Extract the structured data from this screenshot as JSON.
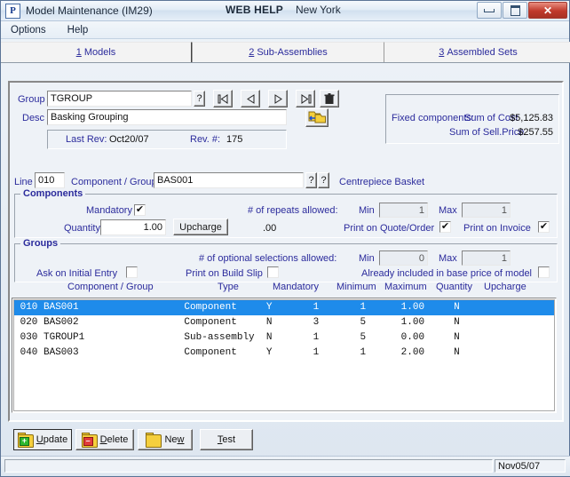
{
  "window": {
    "app_icon_letter": "P",
    "title": "Model Maintenance (IM29)",
    "web_help": "WEB HELP",
    "location": "New York",
    "minimize_label": "Minimize",
    "maximize_label": "Maximize",
    "close_label": "✕"
  },
  "menubar": {
    "items": [
      {
        "label": "Options"
      },
      {
        "label": "Help"
      }
    ]
  },
  "tabs": [
    {
      "accel": "1",
      "label": "Models",
      "selected": false
    },
    {
      "accel": "2",
      "label": "Sub-Assemblies",
      "selected": true
    },
    {
      "accel": "3",
      "label": "Assembled Sets",
      "selected": false
    }
  ],
  "header": {
    "group_label": "Group",
    "group_value": "TGROUP",
    "group_lookup": "?",
    "desc_label": "Desc",
    "desc_value": "Basking Grouping",
    "nav": {
      "first": "first-record",
      "prev": "previous-record",
      "next": "next-record",
      "last": "last-record",
      "delete": "delete-record"
    },
    "copy_label": "copy-group",
    "last_rev_label": "Last Rev:",
    "last_rev_value": "Oct20/07",
    "rev_num_label": "Rev. #:",
    "rev_num_value": "175"
  },
  "summary": {
    "fixed_label": "Fixed components:",
    "cost_label": "Sum of Cost",
    "cost_value": "$5,125.83",
    "sell_label": "Sum of Sell.Price",
    "sell_value": "$257.55"
  },
  "line": {
    "line_label": "Line",
    "line_value": "010",
    "component_label": "Component / Group",
    "component_value": "BAS001",
    "lookup1": "?",
    "lookup2": "?",
    "component_desc": "Centrepiece Basket"
  },
  "components": {
    "title": "Components",
    "mandatory_label": "Mandatory",
    "mandatory_checked": "✔",
    "quantity_label": "Quantity",
    "quantity_value": "1.00",
    "upcharge_button": "Upcharge",
    "upcharge_value": ".00",
    "repeats_label": "# of repeats allowed:",
    "min_label": "Min",
    "min_value": "1",
    "max_label": "Max",
    "max_value": "1",
    "print_quote_label": "Print on Quote/Order",
    "print_quote_checked": "✔",
    "print_invoice_label": "Print on Invoice",
    "print_invoice_checked": "✔"
  },
  "groups": {
    "title": "Groups",
    "optional_label": "# of optional selections allowed:",
    "min_label": "Min",
    "min_value": "0",
    "max_label": "Max",
    "max_value": "1",
    "ask_label": "Ask on Initial Entry",
    "ask_checked": "",
    "build_slip_label": "Print on Build Slip",
    "build_slip_checked": "",
    "base_price_label": "Already included in base price of model",
    "base_price_checked": ""
  },
  "grid": {
    "columns": [
      {
        "label": "Component / Group"
      },
      {
        "label": "Type"
      },
      {
        "label": "Mandatory"
      },
      {
        "label": "Minimum"
      },
      {
        "label": "Maximum"
      },
      {
        "label": "Quantity"
      },
      {
        "label": "Upcharge"
      }
    ],
    "rows": [
      {
        "line": "010",
        "component": "BAS001",
        "type": "Component",
        "mandatory": "Y",
        "minimum": "1",
        "maximum": "1",
        "quantity": "1.00",
        "upcharge": "N",
        "selected": true
      },
      {
        "line": "020",
        "component": "BAS002",
        "type": "Component",
        "mandatory": "N",
        "minimum": "3",
        "maximum": "5",
        "quantity": "1.00",
        "upcharge": "N",
        "selected": false
      },
      {
        "line": "030",
        "component": "TGROUP1",
        "type": "Sub-assembly",
        "mandatory": "N",
        "minimum": "1",
        "maximum": "5",
        "quantity": "0.00",
        "upcharge": "N",
        "selected": false
      },
      {
        "line": "040",
        "component": "BAS003",
        "type": "Component",
        "mandatory": "Y",
        "minimum": "1",
        "maximum": "1",
        "quantity": "2.00",
        "upcharge": "N",
        "selected": false
      }
    ]
  },
  "actions": [
    {
      "name": "update",
      "accel_before": "",
      "accel": "U",
      "rest": "pdate",
      "icon": "folder-plus",
      "focused": true
    },
    {
      "name": "delete",
      "accel_before": "",
      "accel": "D",
      "rest": "elete",
      "icon": "folder-minus",
      "focused": false
    },
    {
      "name": "new",
      "accel_before": "Ne",
      "accel": "w",
      "rest": "",
      "icon": "folder",
      "focused": false
    },
    {
      "name": "test",
      "accel_before": "",
      "accel": "T",
      "rest": "est",
      "icon": "none",
      "focused": false
    }
  ],
  "statusbar": {
    "message": "",
    "date": "Nov05/07"
  },
  "colors": {
    "label_blue": "#2b2b9c",
    "selection_blue": "#1e8bea",
    "close_red": "#c0392b",
    "folder_yellow": "#f5cf3d"
  }
}
